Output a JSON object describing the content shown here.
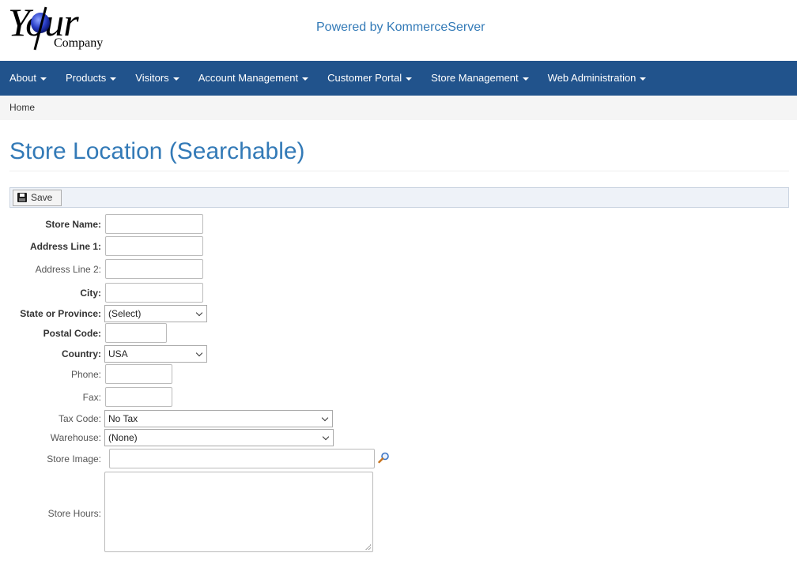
{
  "header": {
    "logo_text_your": "Your",
    "logo_text_company": "Company",
    "powered_by": "Powered by KommerceServer"
  },
  "nav": {
    "items": [
      {
        "label": "About"
      },
      {
        "label": "Products"
      },
      {
        "label": "Visitors"
      },
      {
        "label": "Account Management"
      },
      {
        "label": "Customer Portal"
      },
      {
        "label": "Store Management"
      },
      {
        "label": "Web Administration"
      }
    ]
  },
  "breadcrumb": {
    "home": "Home"
  },
  "page": {
    "title": "Store Location (Searchable)"
  },
  "toolbar": {
    "save_label": "Save"
  },
  "form": {
    "store_name": {
      "label": "Store Name:",
      "value": ""
    },
    "address1": {
      "label": "Address Line 1:",
      "value": ""
    },
    "address2": {
      "label": "Address Line 2:",
      "value": ""
    },
    "city": {
      "label": "City:",
      "value": ""
    },
    "state": {
      "label": "State or Province:",
      "selected": "(Select)"
    },
    "postal": {
      "label": "Postal Code:",
      "value": ""
    },
    "country": {
      "label": "Country:",
      "selected": "USA"
    },
    "phone": {
      "label": "Phone:",
      "value": ""
    },
    "fax": {
      "label": "Fax:",
      "value": ""
    },
    "tax_code": {
      "label": "Tax Code:",
      "selected": "No Tax"
    },
    "warehouse": {
      "label": "Warehouse:",
      "selected": "(None)"
    },
    "store_image": {
      "label": "Store Image:",
      "value": ""
    },
    "store_hours": {
      "label": "Store Hours:",
      "value": ""
    }
  },
  "icons": {
    "save": "floppy-disk-icon",
    "lookup": "magnifier-icon",
    "caret": "caret-down-icon"
  },
  "colors": {
    "navbar": "#21538c",
    "link_blue": "#337ab7"
  }
}
